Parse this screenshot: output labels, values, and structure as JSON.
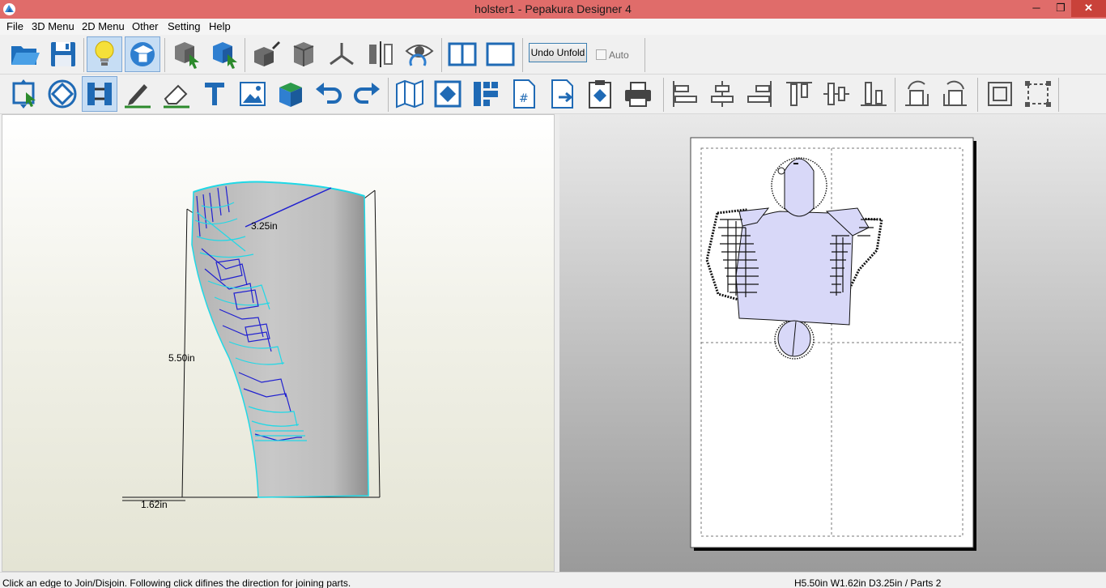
{
  "window": {
    "title": "holster1 - Pepakura Designer 4",
    "minimize_glyph": "─",
    "maximize_glyph": "❐",
    "close_glyph": "✕"
  },
  "menu": {
    "file": "File",
    "menu3d": "3D Menu",
    "menu2d": "2D Menu",
    "other": "Other",
    "setting": "Setting",
    "help": "Help"
  },
  "toolbar": {
    "undo_unfold": "Undo Unfold",
    "auto": "Auto",
    "auto_checked": false
  },
  "view3d": {
    "dim_depth": "3.25in",
    "dim_height": "5.50in",
    "dim_width": "1.62in"
  },
  "status": {
    "message": "Click an edge to Join/Disjoin. Following click difines the direction for joining parts.",
    "info": "H5.50in W1.62in D3.25in / Parts 2"
  },
  "colors": {
    "titlebar": "#e06c6a",
    "selection": "#c6ddf4",
    "part_fill": "#d8d8f8",
    "edge_cyan": "#22e0e8",
    "edge_blue": "#2020d0"
  }
}
